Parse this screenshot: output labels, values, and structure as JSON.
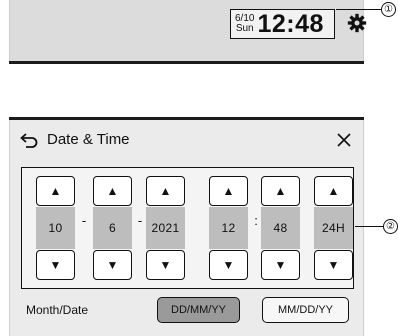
{
  "status_bar": {
    "date": "6/10",
    "weekday": "Sun",
    "time": "12:48",
    "settings_icon": "gear-icon",
    "callout_1": "①"
  },
  "dialog": {
    "title": "Date & Time",
    "back_icon": "back-arrow-icon",
    "close_icon": "close-icon",
    "callout_2": "②",
    "fields": [
      {
        "value": "10",
        "up": "▲",
        "down": "▼"
      },
      {
        "value": "6",
        "up": "▲",
        "down": "▼"
      },
      {
        "value": "2021",
        "up": "▲",
        "down": "▼"
      },
      {
        "value": "12",
        "up": "▲",
        "down": "▼"
      },
      {
        "value": "48",
        "up": "▲",
        "down": "▼"
      },
      {
        "value": "24H",
        "up": "▲",
        "down": "▼"
      }
    ],
    "separators": [
      "-",
      "-",
      ":"
    ],
    "month_date_label": "Month/Date",
    "format_options": [
      {
        "label": "DD/MM/YY",
        "selected": true
      },
      {
        "label": "MM/DD/YY",
        "selected": false
      }
    ]
  },
  "colors": {
    "bar_bg": "#dcdcdc",
    "value_bg": "#bdbdbd",
    "selected_bg": "#9a9a9a"
  }
}
